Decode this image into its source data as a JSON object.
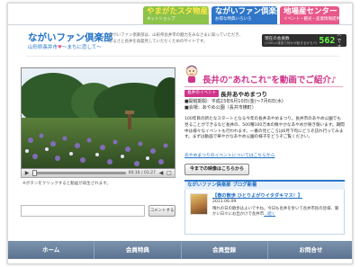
{
  "top_tabs": [
    {
      "title": "やまがたスタ物産館",
      "subtitle": "ネットショップ",
      "color": "#8cc34a"
    },
    {
      "title": "ながいファン倶楽部",
      "subtitle": "お得な特典いろいろ",
      "color": "#2f76c8"
    },
    {
      "title": "地場産センター",
      "subtitle": "イベント・観光・産業情報提供施設",
      "color": "#e8588a"
    }
  ],
  "header": {
    "title": "ながいファン倶楽部",
    "subtitle_left": "山形県長井市",
    "subtitle_heart": "♥",
    "subtitle_right": "～まちに恋して～",
    "description": "ながいファン倶楽部は、山形県長井市の魅力をみなさまに知っていただき、ふるさと長井を再発見していただくためのサイトです。"
  },
  "counter": {
    "label": "現在の会員数",
    "sub_label": "(1500人達成で何かが起きるかも!?)",
    "value": "562",
    "unit": "人です"
  },
  "video_player": {
    "time": "00:16 / 01:27",
    "hint": "※ボタンをクリックすると動画が再生されます。"
  },
  "comment": {
    "button_label": "コメントする"
  },
  "feature": {
    "title": "長井の\"あれこれ\"を動画でご紹介♪",
    "tag": "長井のイベント",
    "event_name": "長井あやめまつり",
    "period": "■開催期間：平成23年6月10日(金)～7月6日(水)",
    "venue": "■会場：あやめ公園（長井市横町）",
    "description": "100年目の新たなスタートとなる今年の長井あやめまつり。長井市のあやめ公園でも見ることができるなど長井の、500種100万本の鮮やかなあやめが咲き競います。期間中は様々なイベントも行われます。一番の見どころは6月下旬にどうぞ訪れ行ってみます。まずは動画で華やかなあやめ公園の様子をどうぞご覧ください。",
    "link_text": "あやめまつりのイベントについてはこちらから",
    "more_button": "今までの映像はこちらから"
  },
  "blog": {
    "header": "ながいファン倶楽部 ブログ新着",
    "post_title": "【春の散歩 ひとりよがりイタダキマス！】",
    "post_date": "2011.06.09",
    "post_body": "晴れの日の散歩はよいですね。今日も長井を歩いて長井市民の皆様、暖かい日々にお出かけで長井市",
    "read_more": "...続く"
  },
  "nav": [
    {
      "label": "ホーム"
    },
    {
      "label": "会員特典"
    },
    {
      "label": "会員登録"
    },
    {
      "label": "お問合せ"
    }
  ]
}
